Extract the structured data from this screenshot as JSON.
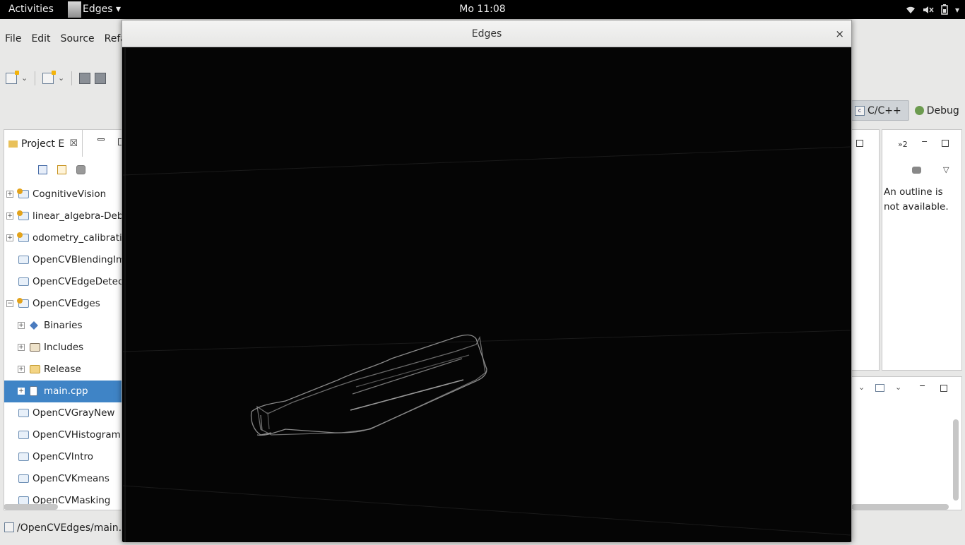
{
  "topbar": {
    "activities": "Activities",
    "app_menu": "Edges ▾",
    "clock": "Mo 11:08",
    "tray_icons": [
      "wifi-icon",
      "volume-icon",
      "battery-icon",
      "chevron-down-icon"
    ]
  },
  "eclipse": {
    "menu": [
      "File",
      "Edit",
      "Source",
      "Refa"
    ],
    "perspectives": {
      "active": "C/C++",
      "other": "Debug"
    },
    "explorer": {
      "tab_label": "Project E",
      "items": [
        {
          "label": "CognitiveVision",
          "type": "project",
          "expander": "+",
          "indent": 0
        },
        {
          "label": "linear_algebra-Debu",
          "type": "project",
          "expander": "+",
          "indent": 0
        },
        {
          "label": "odometry_calibratic",
          "type": "project",
          "expander": "+",
          "indent": 0
        },
        {
          "label": "OpenCVBlendingIm",
          "type": "folder",
          "expander": "",
          "indent": 0
        },
        {
          "label": "OpenCVEdgeDetect",
          "type": "folder",
          "expander": "",
          "indent": 0
        },
        {
          "label": "OpenCVEdges",
          "type": "project-open",
          "expander": "−",
          "indent": 0
        },
        {
          "label": "Binaries",
          "type": "binaries",
          "expander": "+",
          "indent": 1
        },
        {
          "label": "Includes",
          "type": "includes",
          "expander": "+",
          "indent": 1
        },
        {
          "label": "Release",
          "type": "release",
          "expander": "+",
          "indent": 1
        },
        {
          "label": "main.cpp",
          "type": "cpp",
          "expander": "+",
          "indent": 1,
          "selected": true
        },
        {
          "label": "OpenCVGrayNew",
          "type": "folder",
          "expander": "",
          "indent": 0
        },
        {
          "label": "OpenCVHistogram",
          "type": "folder",
          "expander": "",
          "indent": 0
        },
        {
          "label": "OpenCVIntro",
          "type": "folder",
          "expander": "",
          "indent": 0
        },
        {
          "label": "OpenCVKmeans",
          "type": "folder",
          "expander": "",
          "indent": 0
        },
        {
          "label": "OpenCVMasking",
          "type": "folder",
          "expander": "",
          "indent": 0
        }
      ]
    },
    "outline": {
      "chevrons": "»2",
      "message": "An outline is not available."
    },
    "status_path": "/OpenCVEdges/main.cp"
  },
  "image_window": {
    "title": "Edges",
    "close": "×"
  },
  "colors": {
    "selection": "#3f84c6",
    "topbar": "#000000",
    "canvas": "#050505"
  }
}
